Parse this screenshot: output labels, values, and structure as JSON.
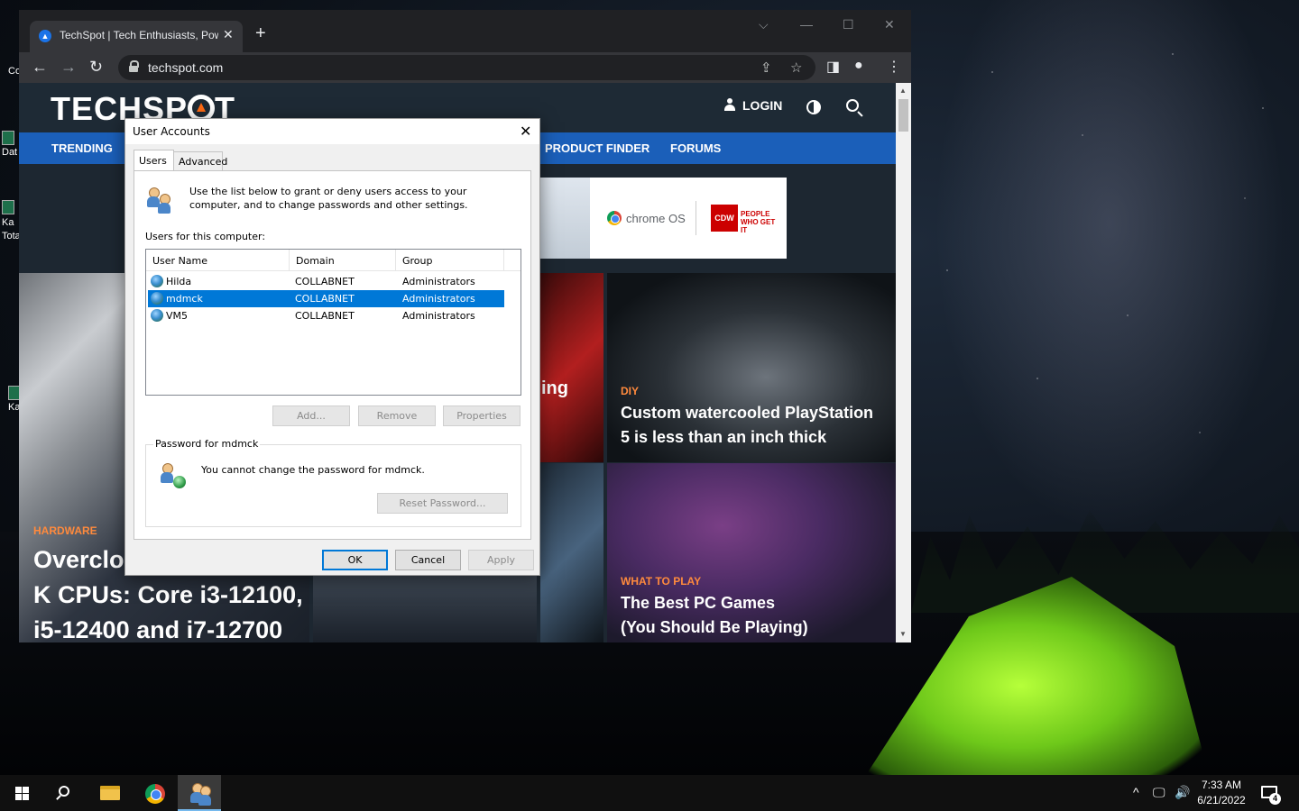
{
  "desktop": {
    "icons": [
      {
        "label": "Co"
      },
      {
        "label": "Dat"
      },
      {
        "label": "Ka Tota"
      },
      {
        "label": "Ka"
      }
    ]
  },
  "browser": {
    "tab_title": "TechSpot | Tech Enthusiasts, Pow",
    "tab_close": "✕",
    "new_tab": "+",
    "url": "techspot.com",
    "window_controls": {
      "dropdown": "⌵",
      "minimize": "—",
      "maximize": "☐",
      "close": "✕"
    },
    "nav": {
      "back": "←",
      "forward": "→",
      "reload": "↻"
    }
  },
  "site": {
    "logo_left": "TECHSP",
    "logo_right": "T",
    "login": "LOGIN",
    "nav_links": [
      "TRENDING",
      "PRODUCT FINDER",
      "FORUMS"
    ],
    "ad": {
      "brand": "chrome OS",
      "cdw": "CDW",
      "cdw_tag": "PEOPLE WHO GET IT"
    },
    "cards": {
      "diy": {
        "category": "DIY",
        "title": "Custom watercooled PlayStation 5 is less than an inch thick"
      },
      "games": {
        "category": "WHAT TO PLAY",
        "title": "The Best PC Games (You Should Be Playing)"
      },
      "hardware": {
        "category": "HARDWARE",
        "title_line1": "Overcloc",
        "title_line2": "K CPUs: Core i3-12100,",
        "title_line3": "i5-12400 and i7-12700"
      },
      "partial": "ing"
    }
  },
  "dialog": {
    "title": "User Accounts",
    "close": "✕",
    "tabs": [
      "Users",
      "Advanced"
    ],
    "intro": "Use the list below to grant or deny users access to your computer, and to change passwords and other settings.",
    "users_label": "Users for this computer:",
    "columns": [
      "User Name",
      "Domain",
      "Group"
    ],
    "users": [
      {
        "name": "Hilda",
        "domain": "COLLABNET",
        "group": "Administrators"
      },
      {
        "name": "mdmck",
        "domain": "COLLABNET",
        "group": "Administrators"
      },
      {
        "name": "VM5",
        "domain": "COLLABNET",
        "group": "Administrators"
      }
    ],
    "buttons": {
      "add": "Add...",
      "remove": "Remove",
      "properties": "Properties",
      "reset": "Reset Password...",
      "ok": "OK",
      "cancel": "Cancel",
      "apply": "Apply"
    },
    "password_group": "Password for mdmck",
    "password_text": "You cannot change the password for mdmck."
  },
  "taskbar": {
    "time": "7:33 AM",
    "date": "6/21/2022",
    "tray": {
      "chevron": "^",
      "network": "🖵",
      "volume": "🔊"
    },
    "notifications": "4"
  }
}
